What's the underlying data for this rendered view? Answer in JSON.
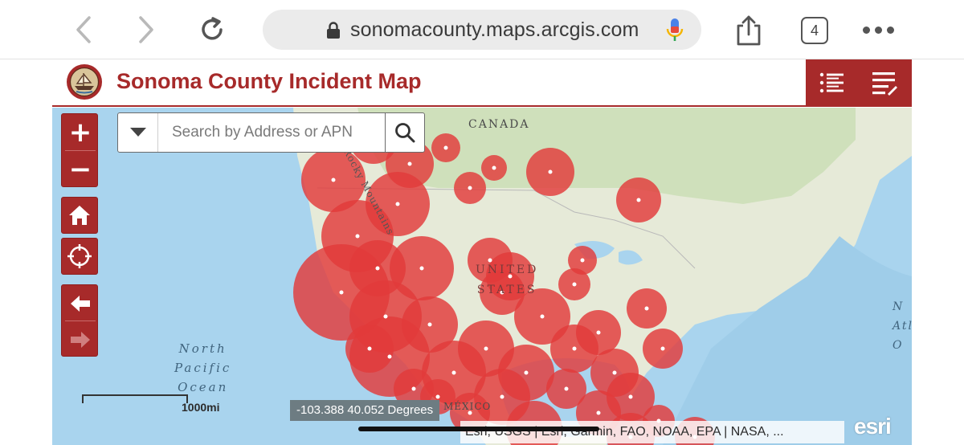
{
  "browser": {
    "url": "sonomacounty.maps.arcgis.com",
    "tab_count": "4",
    "icons": [
      "back-icon",
      "forward-icon",
      "reload-icon",
      "lock-icon",
      "microphone-icon",
      "share-icon",
      "more-icon"
    ]
  },
  "app": {
    "title": "Sonoma County Incident Map",
    "accent_color": "#a72a2a",
    "header_tools": [
      "legend-icon",
      "layer-list-icon"
    ]
  },
  "search": {
    "placeholder": "Search by Address or APN"
  },
  "map": {
    "labels": {
      "canada": "CANADA",
      "us_line1": "UNITED",
      "us_line2": "STATES",
      "ocean_line1": "North",
      "ocean_line2": "Pacific",
      "ocean_line3": "Ocean",
      "mexico": "MÉXICO",
      "rocky": "Rocky Mountains",
      "atlantic_line1": "N",
      "atlantic_line2": "Atl",
      "atlantic_line3": "O"
    },
    "controls": {
      "zoom_in": "+",
      "zoom_out": "−"
    },
    "scale_label": "1000mi",
    "coordinates": "-103.388 40.052 Degrees",
    "attribution": "Esri, USGS | Esri, Garmin, FAO, NOAA, EPA | NASA, ...",
    "esri_logo": "esri",
    "incident_color": "#e23b3b"
  }
}
